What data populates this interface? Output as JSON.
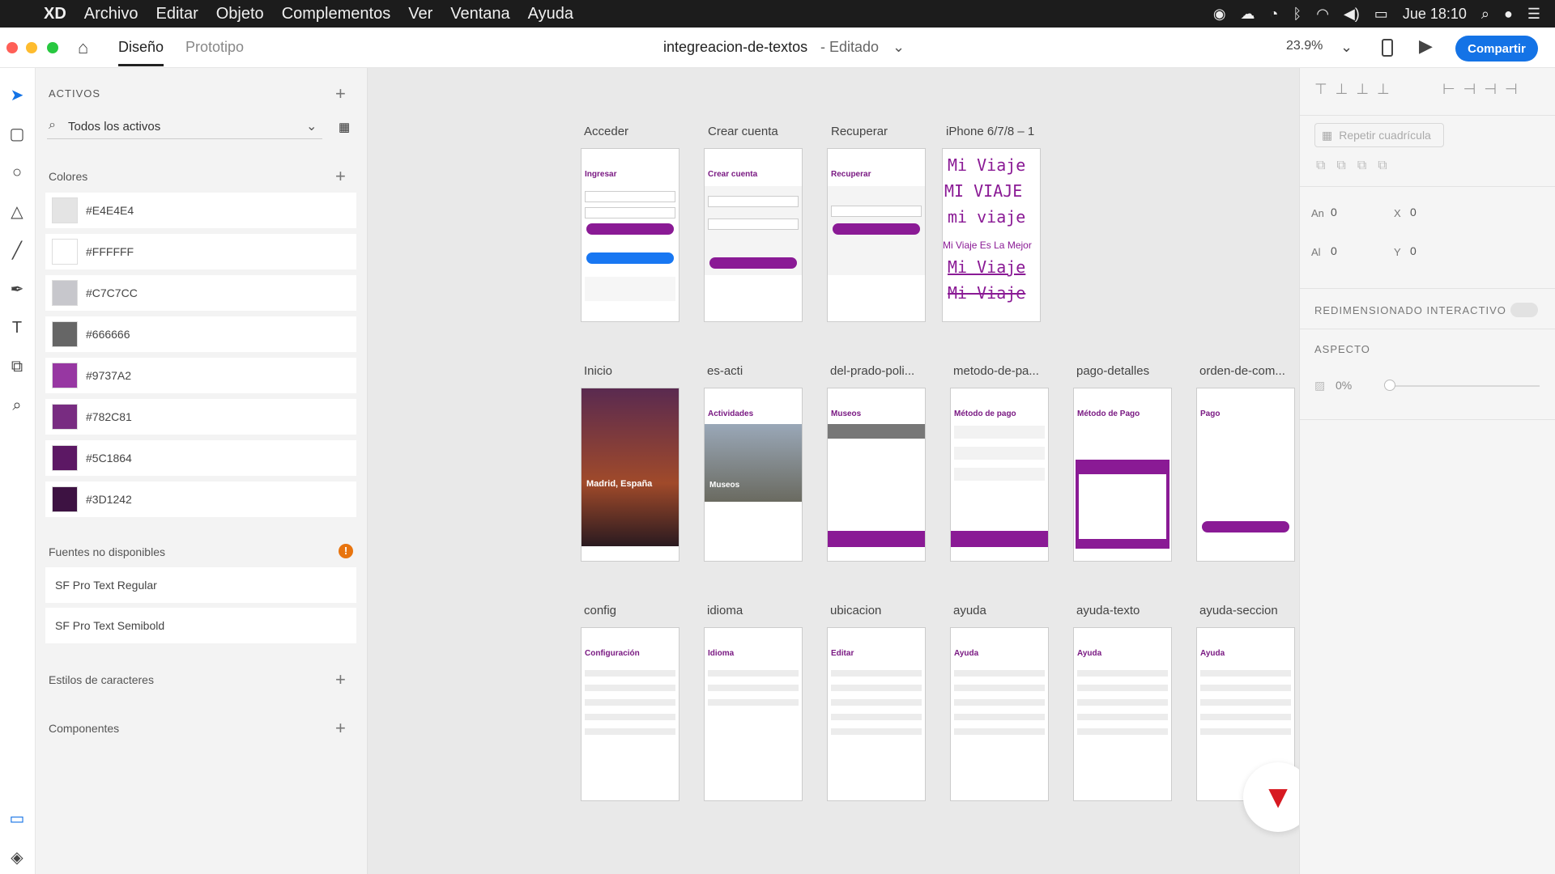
{
  "menubar": {
    "app": "XD",
    "items": [
      "Archivo",
      "Editar",
      "Objeto",
      "Complementos",
      "Ver",
      "Ventana",
      "Ayuda"
    ],
    "clock": "Jue 18:10"
  },
  "toolbar": {
    "tab_design": "Diseño",
    "tab_prototype": "Prototipo",
    "doc_title": "integreacion-de-textos",
    "doc_status": "- Editado",
    "zoom": "23.9%",
    "share": "Compartir"
  },
  "assets": {
    "title": "ACTIVOS",
    "filter": "Todos los activos",
    "colors_title": "Colores",
    "colors": [
      {
        "hex": "#E4E4E4",
        "label": "#E4E4E4"
      },
      {
        "hex": "#FFFFFF",
        "label": "#FFFFFF"
      },
      {
        "hex": "#C7C7CC",
        "label": "#C7C7CC"
      },
      {
        "hex": "#666666",
        "label": "#666666"
      },
      {
        "hex": "#9737A2",
        "label": "#9737A2"
      },
      {
        "hex": "#782C81",
        "label": "#782C81"
      },
      {
        "hex": "#5C1864",
        "label": "#5C1864"
      },
      {
        "hex": "#3D1242",
        "label": "#3D1242"
      }
    ],
    "fonts_title": "Fuentes no disponibles",
    "fonts": [
      "SF Pro Text Regular",
      "SF Pro Text Semibold"
    ],
    "char_styles": "Estilos de caracteres",
    "components": "Componentes"
  },
  "artboards": {
    "row1": [
      "Acceder",
      "Crear cuenta",
      "Recuperar",
      "iPhone 6/7/8 – 1"
    ],
    "row2": [
      "Inicio",
      "es-acti",
      "del-prado-poli...",
      "metodo-de-pa...",
      "pago-detalles",
      "orden-de-com..."
    ],
    "row3": [
      "config",
      "idioma",
      "ubicacion",
      "ayuda",
      "ayuda-texto",
      "ayuda-seccion"
    ],
    "headers1": [
      "Ingresar",
      "Crear cuenta",
      "Recuperar"
    ],
    "headers2": [
      "",
      "Actividades",
      "Museos",
      "Método de pago",
      "Método de Pago",
      "Pago"
    ],
    "headers3": [
      "Configuración",
      "Idioma",
      "Editar",
      "Ayuda",
      "Ayuda",
      "Ayuda"
    ],
    "iphone_texts": [
      "Mi Viaje",
      "MI VIAJE",
      "mi viaje",
      "Mi Viaje Es La Mejor",
      "Mi Viaje",
      "Mi Viaje"
    ],
    "inicio_city": "Madrid, España",
    "museos": "Museos"
  },
  "props": {
    "repeat_grid": "Repetir cuadrícula",
    "w_label": "An",
    "w_val": "0",
    "x_label": "X",
    "x_val": "0",
    "h_label": "Al",
    "h_val": "0",
    "y_label": "Y",
    "y_val": "0",
    "responsive": "REDIMENSIONADO INTERACTIVO",
    "appearance": "ASPECTO",
    "opacity": "0%"
  },
  "accent": "#1473e6",
  "brand": "#8a1a95"
}
